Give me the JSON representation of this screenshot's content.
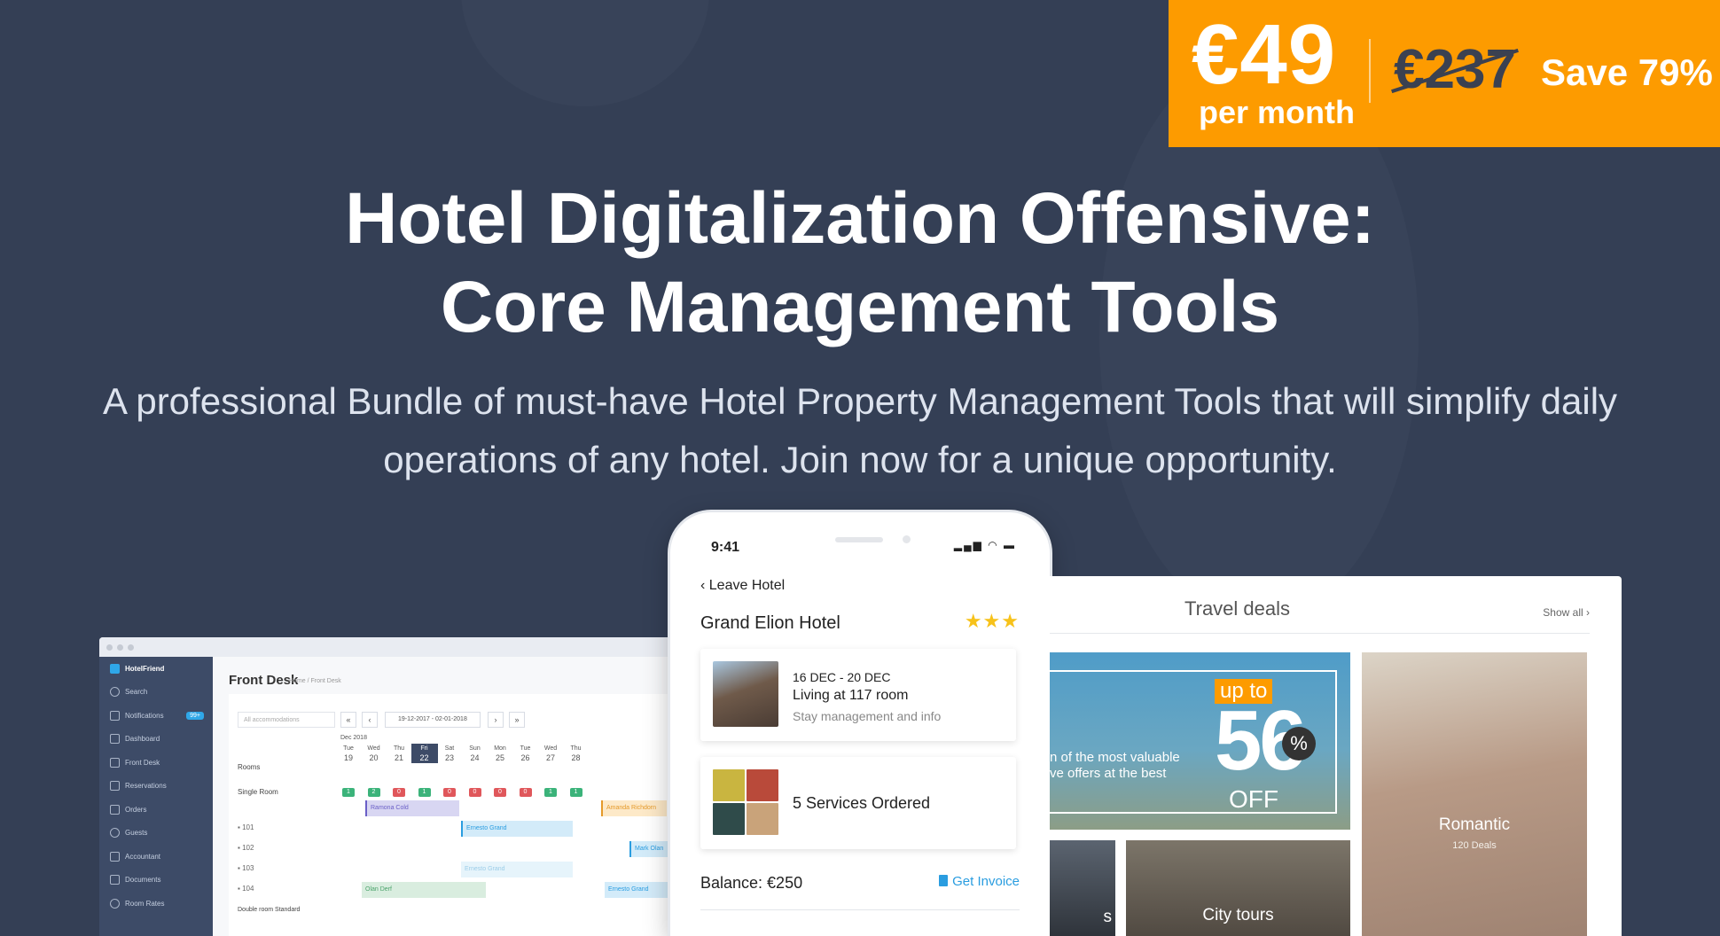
{
  "badge": {
    "price": "€49",
    "period": "per month",
    "old_price": "€237",
    "save": "Save 79%",
    "color": "#fd9b00"
  },
  "hero": {
    "title_line1": "Hotel Digitalization Offensive:",
    "title_line2": "Core Management Tools",
    "subtitle_line1": "A professional Bundle of must-have Hotel Property Management Tools that will simplify daily",
    "subtitle_line2": "operations of any hotel. Join now for a unique opportunity."
  },
  "desktop": {
    "sidebar": [
      {
        "label": "HotelFriend",
        "icon": "hotel-logo-icon"
      },
      {
        "label": "Search",
        "icon": "search-icon"
      },
      {
        "label": "Notifications",
        "icon": "bell-icon",
        "badge": "99+"
      },
      {
        "label": "Dashboard",
        "icon": "home-icon"
      },
      {
        "label": "Front Desk",
        "icon": "calendar-icon"
      },
      {
        "label": "Reservations",
        "icon": "document-icon"
      },
      {
        "label": "Orders",
        "icon": "tray-icon"
      },
      {
        "label": "Guests",
        "icon": "user-icon"
      },
      {
        "label": "Accountant",
        "icon": "grid-icon"
      },
      {
        "label": "Documents",
        "icon": "folder-icon"
      },
      {
        "label": "Room Rates",
        "icon": "tag-icon"
      }
    ],
    "page_title": "Front Desk",
    "breadcrumb": "Home / Front Desk",
    "filter_placeholder": "All accommodations",
    "date_range": "19-12-2017 - 02-01-2018",
    "month": "Dec 2018",
    "days": [
      {
        "dow": "Tue",
        "num": "19"
      },
      {
        "dow": "Wed",
        "num": "20"
      },
      {
        "dow": "Thu",
        "num": "21"
      },
      {
        "dow": "Fri",
        "num": "22"
      },
      {
        "dow": "Sat",
        "num": "23"
      },
      {
        "dow": "Sun",
        "num": "24"
      },
      {
        "dow": "Mon",
        "num": "25"
      },
      {
        "dow": "Tue",
        "num": "26"
      },
      {
        "dow": "Wed",
        "num": "27"
      },
      {
        "dow": "Thu",
        "num": "28"
      }
    ],
    "rooms_header": "Rooms",
    "single_room": "Single Room",
    "availability": [
      "1",
      "2",
      "0",
      "1",
      "0",
      "0",
      "0",
      "0",
      "1",
      "1"
    ],
    "rooms": [
      "101",
      "102",
      "103",
      "104"
    ],
    "double_room": "Double room Standard",
    "bookings": [
      {
        "name": "Ramona Cold"
      },
      {
        "name": "Amanda Richdorn"
      },
      {
        "name": "Ernesto Grand"
      },
      {
        "name": "Mark Olan"
      },
      {
        "name": "Ernesto Grand"
      },
      {
        "name": "Olan Derf"
      },
      {
        "name": "Ernesto Grand"
      }
    ]
  },
  "phone": {
    "time": "9:41",
    "back_label": "Leave Hotel",
    "hotel_name": "Grand Elion Hotel",
    "stars": "★★★",
    "stay_dates": "16 DEC - 20 DEC",
    "stay_room": "Living at 117 room",
    "stay_info": "Stay management and info",
    "services": "5 Services Ordered",
    "balance": "Balance: €250",
    "invoice": "Get Invoice"
  },
  "travel": {
    "title": "Travel deals",
    "show_all": "Show all",
    "deal_text_line1": "n of the most valuable",
    "deal_text_line2": "ve offers at the best",
    "up_to": "up to",
    "discount": "56",
    "percent": "%",
    "off": "OFF",
    "romantic": "Romantic",
    "romantic_count": "120 Deals",
    "city_tours": "City tours",
    "small_fragment": "s"
  }
}
